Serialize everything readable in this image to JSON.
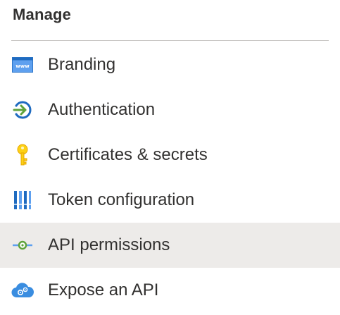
{
  "section": {
    "title": "Manage"
  },
  "menu": {
    "items": [
      {
        "label": "Branding",
        "icon": "browser-window-icon",
        "selected": false
      },
      {
        "label": "Authentication",
        "icon": "sign-in-arrow-icon",
        "selected": false
      },
      {
        "label": "Certificates & secrets",
        "icon": "key-icon",
        "selected": false
      },
      {
        "label": "Token configuration",
        "icon": "token-bars-icon",
        "selected": false
      },
      {
        "label": "API permissions",
        "icon": "api-link-icon",
        "selected": true
      },
      {
        "label": "Expose an API",
        "icon": "cloud-gear-icon",
        "selected": false
      }
    ]
  },
  "colors": {
    "selected_background": "#edebe9",
    "text": "#323130",
    "divider": "#c8c6c4",
    "azure_blue": "#0078d4",
    "green": "#5ea33b",
    "key_yellow": "#fcd116"
  }
}
